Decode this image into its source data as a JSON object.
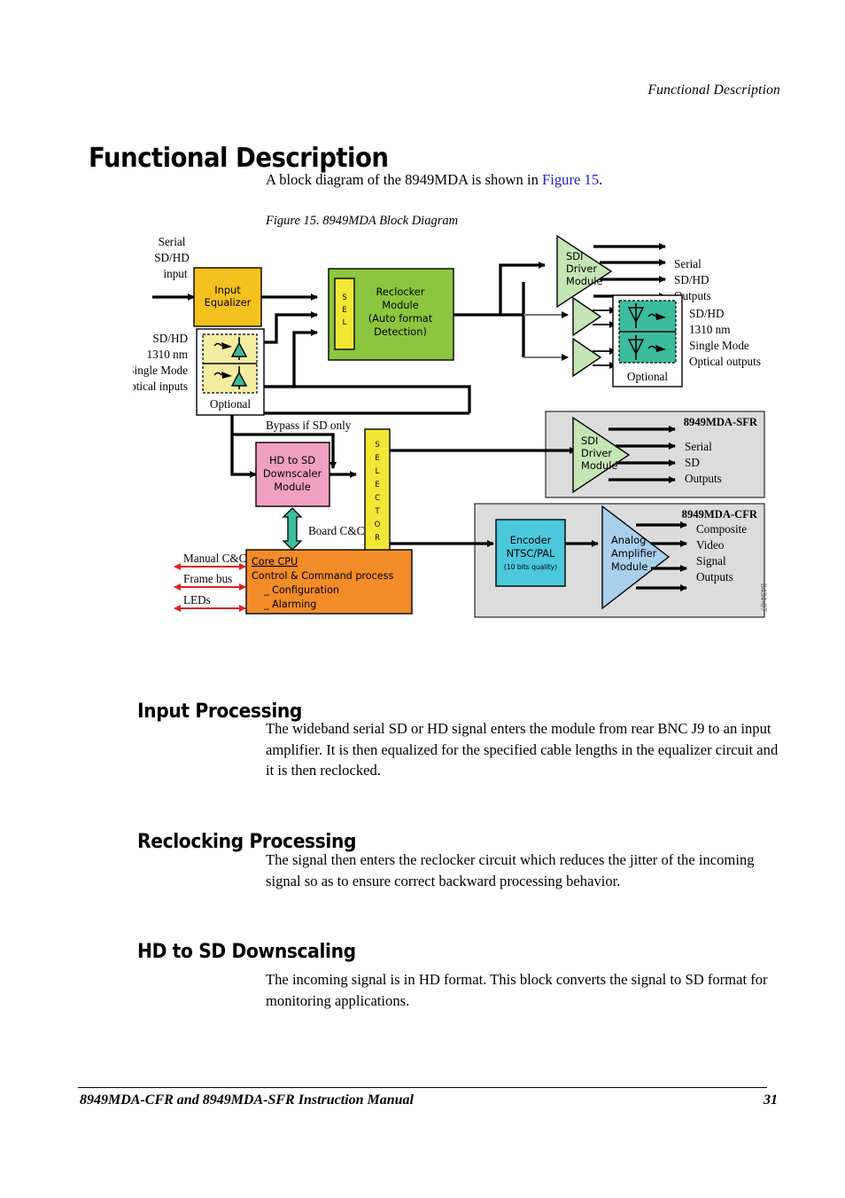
{
  "page": {
    "running_head": "Functional Description",
    "title": "Functional Description",
    "lead_pre": "A block diagram of the 8949MDA is shown in ",
    "lead_ref": "Figure 15",
    "lead_post": ".",
    "figure_caption": "Figure 15.  8949MDA Block Diagram",
    "footer_left": "8949MDA-CFR and 8949MDA-SFR Instruction Manual",
    "footer_page": "31"
  },
  "sections": [
    {
      "heading": "Input Processing",
      "body": "The wideband serial SD or HD signal enters the module from rear BNC J9 to an input amplifier. It is then equalized for the specified cable lengths in the equalizer circuit and it is then reclocked."
    },
    {
      "heading": "Reclocking Processing",
      "body": "The signal then enters the reclocker circuit which reduces the jitter of the incoming signal so as to ensure correct backward processing behavior."
    },
    {
      "heading": "HD to SD Downscaling",
      "body": "The incoming signal is in HD format. This block converts the signal to SD format for monitoring applications."
    }
  ],
  "diagram": {
    "id_code": "8434-07",
    "labels": {
      "serial_input_1": "Serial",
      "serial_input_2": "SD/HD",
      "serial_input_3": "input",
      "optical_input_1": "SD/HD",
      "optical_input_2": "1310 nm",
      "optical_input_3": "Single Mode",
      "optical_input_4": "Optical inputs",
      "optional_in": "Optional",
      "optional_out": "Optional",
      "bypass": "Bypass if SD only",
      "board_cc": "Board C&C",
      "manual_cc": "Manual C&C",
      "frame_bus": "Frame bus",
      "leds": "LEDs",
      "sdi_out_1": "Serial",
      "sdi_out_2": "SD/HD",
      "sdi_out_3": "Outputs",
      "optical_out_1": "SD/HD",
      "optical_out_2": "1310 nm",
      "optical_out_3": "Single Mode",
      "optical_out_4": "Optical outputs",
      "sfr_title": "8949MDA-SFR",
      "sfr_out_1": "Serial",
      "sfr_out_2": "SD",
      "sfr_out_3": "Outputs",
      "cfr_title": "8949MDA-CFR",
      "cfr_out_1": "Composite",
      "cfr_out_2": "Video",
      "cfr_out_3": "Signal",
      "cfr_out_4": "Outputs"
    },
    "blocks": {
      "input_equalizer": {
        "line1": "Input",
        "line2": "Equalizer",
        "color": "#F5C11E"
      },
      "sel_strip": {
        "l1": "S",
        "l2": "E",
        "l3": "L",
        "color": "#F2E735"
      },
      "reclocker": {
        "line1": "Reclocker",
        "line2": "Module",
        "line3": "(Auto format",
        "line4": "Detection)",
        "color": "#8CC63E"
      },
      "downscaler": {
        "line1": "HD to SD",
        "line2": "Downscaler",
        "line3": "Module",
        "color": "#F0A0C0"
      },
      "selector": {
        "letters": "SELECTOR",
        "color": "#F2E735"
      },
      "sdi_driver_top": {
        "line1": "SDI",
        "line2": "Driver",
        "line3": "Module",
        "color": "#C5E5B5"
      },
      "sdi_driver_sfr": {
        "line1": "SDI",
        "line2": "Driver",
        "line3": "Module",
        "color": "#C5E5B5"
      },
      "encoder": {
        "line1": "Encoder",
        "line2": "NTSC/PAL",
        "line3": "(10 bits quality)",
        "color": "#4BC8DC"
      },
      "analog_amp": {
        "line1": "Analog",
        "line2": "Amplifier",
        "line3": "Module",
        "color": "#A8CFEC"
      },
      "core_cpu": {
        "title": "Core CPU",
        "line2": "Control & Command process",
        "line3": "_ Configuration",
        "line4": "_ Alarming",
        "color": "#F28C28"
      },
      "optical_in_box": {
        "color": "#F2EDA0"
      },
      "optical_out_box": {
        "color": "#3CBC9E"
      },
      "panel_sfr": {
        "color": "#DCDCDC"
      },
      "panel_cfr": {
        "color": "#DCDCDC"
      }
    }
  }
}
